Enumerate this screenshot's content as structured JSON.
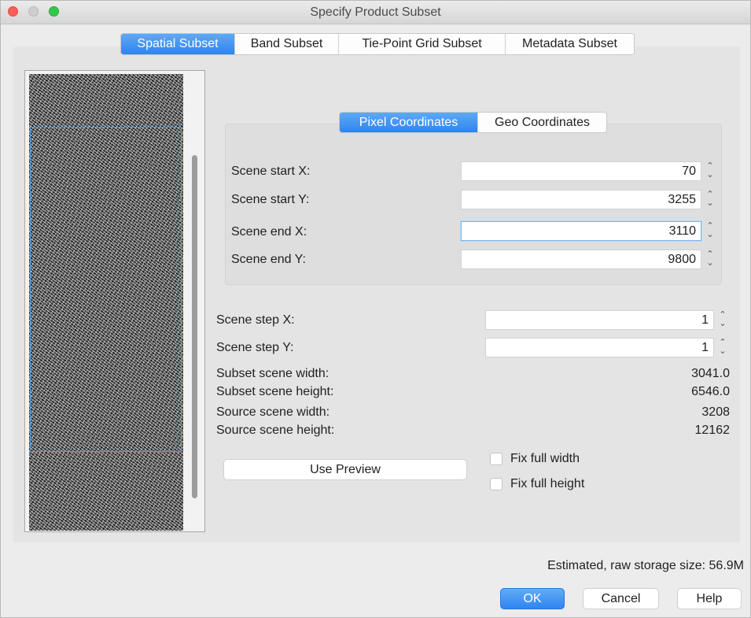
{
  "window": {
    "title": "Specify Product Subset"
  },
  "tabs": [
    {
      "label": "Spatial Subset",
      "active": true
    },
    {
      "label": "Band Subset",
      "active": false
    },
    {
      "label": "Tie-Point Grid Subset",
      "active": false
    },
    {
      "label": "Metadata Subset",
      "active": false
    }
  ],
  "coord_tabs": [
    {
      "label": "Pixel Coordinates",
      "active": true
    },
    {
      "label": "Geo Coordinates",
      "active": false
    }
  ],
  "fields": {
    "scene_start_x": {
      "label": "Scene start X:",
      "value": "70"
    },
    "scene_start_y": {
      "label": "Scene start Y:",
      "value": "3255"
    },
    "scene_end_x": {
      "label": "Scene end X:",
      "value": "3110"
    },
    "scene_end_y": {
      "label": "Scene end Y:",
      "value": "9800"
    },
    "scene_step_x": {
      "label": "Scene step X:",
      "value": "1"
    },
    "scene_step_y": {
      "label": "Scene step Y:",
      "value": "1"
    }
  },
  "info": {
    "subset_width": {
      "label": "Subset scene width:",
      "value": "3041.0"
    },
    "subset_height": {
      "label": "Subset scene height:",
      "value": "6546.0"
    },
    "source_width": {
      "label": "Source scene width:",
      "value": "3208"
    },
    "source_height": {
      "label": "Source scene height:",
      "value": "12162"
    }
  },
  "use_preview_label": "Use Preview",
  "checkboxes": {
    "fix_full_width": {
      "label": "Fix full width",
      "checked": false
    },
    "fix_full_height": {
      "label": "Fix full height",
      "checked": false
    }
  },
  "storage_text": "Estimated, raw storage size: 56.9M",
  "buttons": {
    "ok": "OK",
    "cancel": "Cancel",
    "help": "Help"
  },
  "colors": {
    "accent": "#2f84ef",
    "close": "#fc5f57",
    "maximize": "#34c84a",
    "selection": "#5a9be6"
  },
  "icons": [
    "window-close-icon",
    "window-minimize-icon",
    "window-maximize-icon",
    "spinner-arrows-icon"
  ]
}
